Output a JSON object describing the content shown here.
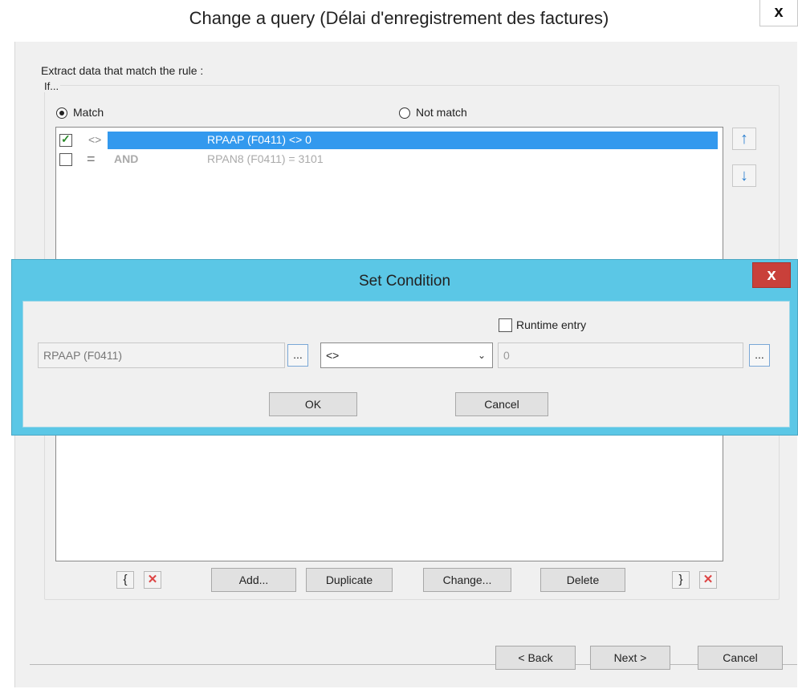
{
  "window": {
    "title": "Change a query (Délai d'enregistrement des factures)",
    "close_label": "x"
  },
  "rule": {
    "instruction": "Extract data that match the rule :",
    "group_label": "If...",
    "match_label": "Match",
    "not_match_label": "Not match",
    "selected_option": "Match"
  },
  "conditions": [
    {
      "checked": true,
      "operator": "<>",
      "conjunction": "",
      "text": "RPAAP (F0411) <> 0",
      "selected": true
    },
    {
      "checked": false,
      "operator": "=",
      "conjunction": "AND",
      "text": "RPAN8 (F0411) = 3101",
      "selected": false
    }
  ],
  "list_buttons": {
    "add": "Add...",
    "duplicate": "Duplicate",
    "change": "Change...",
    "delete": "Delete",
    "open_brace": "{",
    "close_brace": "}",
    "remove_mark": "✕"
  },
  "move_buttons": {
    "up": "↑",
    "down": "↓"
  },
  "wizard": {
    "back": "< Back",
    "next": "Next >",
    "cancel": "Cancel"
  },
  "modal": {
    "title": "Set Condition",
    "close_label": "x",
    "runtime_entry_label": "Runtime entry",
    "runtime_entry_checked": false,
    "field_value": "RPAAP (F0411)",
    "operator_value": "<>",
    "compare_value": "0",
    "browse_label": "...",
    "ok_label": "OK",
    "cancel_label": "Cancel"
  },
  "colors": {
    "selection": "#3399ee",
    "modal_frame": "#5bc7e6",
    "modal_close": "#c9403a",
    "arrow": "#2b7fd0"
  }
}
